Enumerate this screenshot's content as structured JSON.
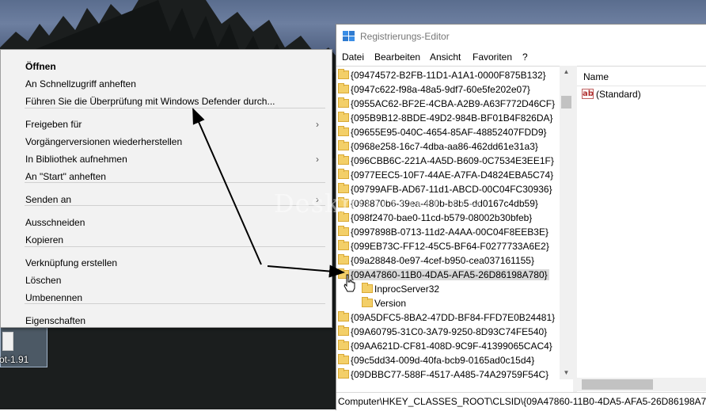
{
  "desktop": {
    "icon_label": "ot-1.91",
    "watermark": "Deskmodder.de"
  },
  "regedit": {
    "title": "Registrierungs-Editor",
    "menu": [
      "Datei",
      "Bearbeiten",
      "Ansicht",
      "Favoriten",
      "?"
    ],
    "tree": [
      {
        "label": "{09474572-B2FB-11D1-A1A1-0000F875B132}"
      },
      {
        "label": "{0947c622-f98a-48a5-9df7-60e5fe202e07}"
      },
      {
        "label": "{0955AC62-BF2E-4CBA-A2B9-A63F772D46CF}"
      },
      {
        "label": "{095B9B12-8BDE-49D2-984B-BF01B4F826DA}"
      },
      {
        "label": "{09655E95-040C-4654-85AF-48852407FDD9}"
      },
      {
        "label": "{0968e258-16c7-4dba-aa86-462dd61e31a3}"
      },
      {
        "label": "{096CBB6C-221A-4A5D-B609-0C7534E3EE1F}"
      },
      {
        "label": "{0977EEC5-10F7-44AE-A7FA-D4824EBA5C74}"
      },
      {
        "label": "{09799AFB-AD67-11d1-ABCD-00C04FC30936}"
      },
      {
        "label": "{098870b6-39ea-480b-b8b5-dd0167c4db59}"
      },
      {
        "label": "{098f2470-bae0-11cd-b579-08002b30bfeb}"
      },
      {
        "label": "{0997898B-0713-11d2-A4AA-00C04F8EEB3E}"
      },
      {
        "label": "{099EB73C-FF12-45C5-BF64-F0277733A6E2}"
      },
      {
        "label": "{09a28848-0e97-4cef-b950-cea037161155}"
      },
      {
        "label": "{09A47860-11B0-4DA5-AFA5-26D86198A780}",
        "selected": true
      },
      {
        "label": "InprocServer32",
        "child": true
      },
      {
        "label": "Version",
        "child": true
      },
      {
        "label": "{09A5DFC5-8BA2-47DD-BF84-FFD7E0B24481}"
      },
      {
        "label": "{09A60795-31C0-3A79-9250-8D93C74FE540}"
      },
      {
        "label": "{09AA621D-CF81-408D-9C9F-41399065CAC4}"
      },
      {
        "label": "{09c5dd34-009d-40fa-bcb9-0165ad0c15d4}"
      },
      {
        "label": "{09DBBC77-588F-4517-A485-74A29759F54C}"
      }
    ],
    "values_header": "Name",
    "values": [
      {
        "icon": "ab",
        "name": "(Standard)"
      }
    ],
    "status_path": "Computer\\HKEY_CLASSES_ROOT\\CLSID\\{09A47860-11B0-4DA5-AFA5-26D86198A780}"
  },
  "context_menu": {
    "items": [
      {
        "label": "Öffnen",
        "bold": true
      },
      {
        "label": "An Schnellzugriff anheften"
      },
      {
        "label": "Führen Sie die Überprüfung mit Windows Defender durch..."
      },
      {
        "label": "Freigeben für",
        "submenu": true
      },
      {
        "label": "Vorgängerversionen wiederherstellen"
      },
      {
        "label": "In Bibliothek aufnehmen",
        "submenu": true
      },
      {
        "label": "An \"Start\" anheften"
      },
      {
        "label": "Senden an",
        "submenu": true
      },
      {
        "label": "Ausschneiden"
      },
      {
        "label": "Kopieren"
      },
      {
        "label": "Verknüpfung erstellen"
      },
      {
        "label": "Löschen"
      },
      {
        "label": "Umbenennen"
      },
      {
        "label": "Eigenschaften"
      }
    ]
  },
  "colors": {
    "folder": "#f3cf68",
    "selection": "#d9d9d9",
    "menu_bg": "#f2f2f2"
  }
}
